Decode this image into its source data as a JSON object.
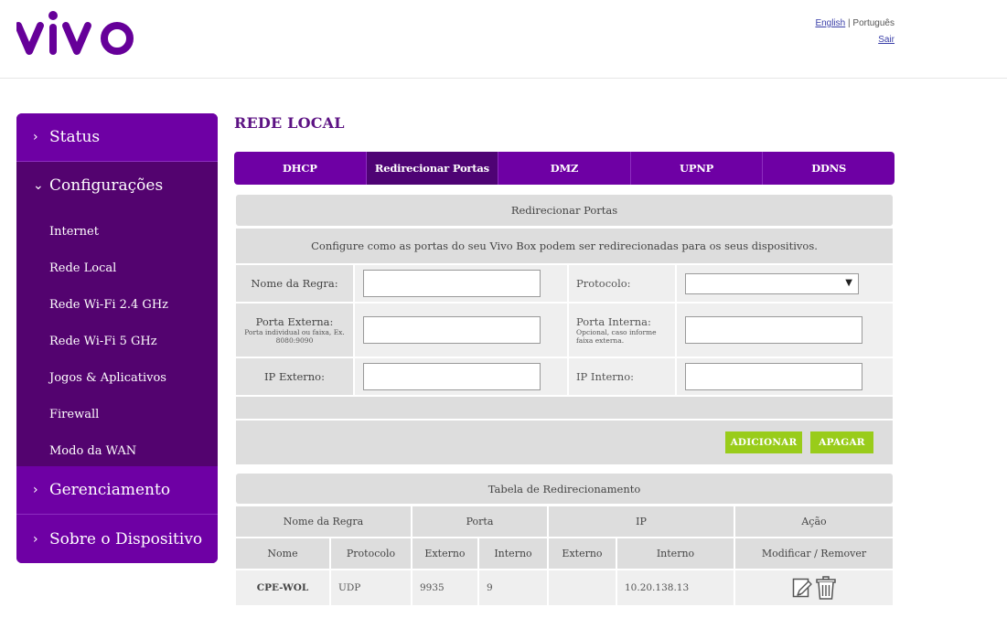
{
  "brand": {
    "logo_text": "vivo",
    "color": "#660099"
  },
  "header": {
    "lang_english": "English",
    "lang_separator": " | ",
    "lang_portugues": "Português",
    "logout": "Sair"
  },
  "sidebar": {
    "status": "Status",
    "configuracoes": "Configurações",
    "sub_items": [
      "Internet",
      "Rede Local",
      "Rede Wi-Fi 2.4 GHz",
      "Rede Wi-Fi 5 GHz",
      "Jogos & Aplicativos",
      "Firewall",
      "Modo da WAN"
    ],
    "gerenciamento": "Gerenciamento",
    "sobre": "Sobre o Dispositivo"
  },
  "page_title": "REDE LOCAL",
  "tabs": [
    "DHCP",
    "Redirecionar Portas",
    "DMZ",
    "UPNP",
    "DDNS"
  ],
  "active_tab": "Redirecionar Portas",
  "form": {
    "section_title": "Redirecionar Portas",
    "description": "Configure como as portas do seu Vivo Box podem ser redirecionadas para os seus dispositivos.",
    "nome_regra_label": "Nome da Regra:",
    "nome_regra_value": "",
    "protocolo_label": "Protocolo:",
    "protocolo_value": "",
    "porta_externa_label": "Porta Externa:",
    "porta_externa_hint": "Porta individual ou faixa, Ex. 8080:9090",
    "porta_externa_value": "",
    "porta_interna_label": "Porta Interna:",
    "porta_interna_hint": "Opcional, caso informe faixa externa.",
    "porta_interna_value": "",
    "ip_externo_label": "IP Externo:",
    "ip_externo_value": "",
    "ip_interno_label": "IP Interno:",
    "ip_interno_value": "",
    "add_button": "ADICIONAR",
    "delete_button": "APAGAR"
  },
  "table": {
    "title": "Tabela de Redirecionamento",
    "group_headers": [
      "Nome da Regra",
      "Porta",
      "IP",
      "Ação"
    ],
    "sub_headers": [
      "Nome",
      "Protocolo",
      "Externo",
      "Interno",
      "Externo",
      "Interno",
      "Modificar / Remover"
    ],
    "rows": [
      {
        "nome": "CPE-WOL",
        "protocolo": "UDP",
        "porta_externo": "9935",
        "porta_interno": "9",
        "ip_externo": "",
        "ip_interno": "10.20.138.13"
      }
    ]
  },
  "colors": {
    "purple": "#6e00a4",
    "purple_dark": "#53036f",
    "green": "#99cc1a"
  }
}
